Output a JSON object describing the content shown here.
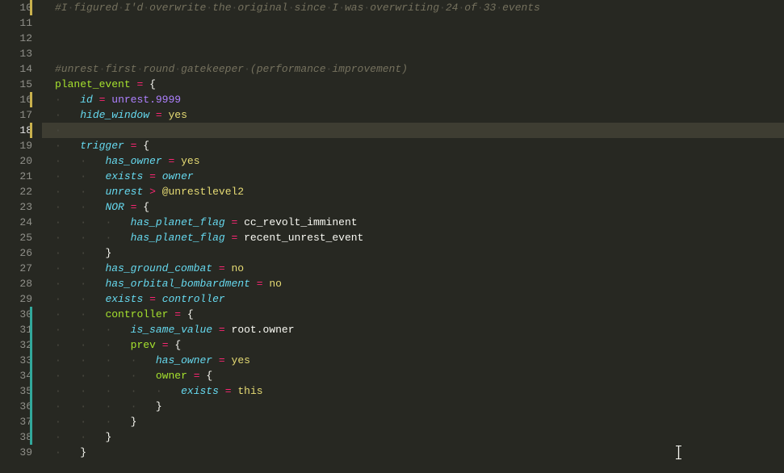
{
  "editor": {
    "first_line": 10,
    "active_line": 18,
    "caret": {
      "line": 39,
      "col": 99
    },
    "colors": {
      "background": "#272822",
      "gutter_fg": "#90908a",
      "gutter_active_fg": "#e6e6e6",
      "active_line_bg": "#3e3d32",
      "whitespace": "#4b4a41",
      "mod_yellow": "#c9b14d",
      "mod_teal": "#32a89c"
    },
    "lines": [
      {
        "num": 10,
        "indent": 0,
        "mod": "yellow",
        "tokens": [
          [
            "comment",
            "#I"
          ],
          [
            "ws",
            "·"
          ],
          [
            "comment",
            "figured"
          ],
          [
            "ws",
            "·"
          ],
          [
            "comment",
            "I'd"
          ],
          [
            "ws",
            "·"
          ],
          [
            "comment",
            "overwrite"
          ],
          [
            "ws",
            "·"
          ],
          [
            "comment",
            "the"
          ],
          [
            "ws",
            "·"
          ],
          [
            "comment",
            "original"
          ],
          [
            "ws",
            "·"
          ],
          [
            "comment",
            "since"
          ],
          [
            "ws",
            "·"
          ],
          [
            "comment",
            "I"
          ],
          [
            "ws",
            "·"
          ],
          [
            "comment",
            "was"
          ],
          [
            "ws",
            "·"
          ],
          [
            "comment",
            "overwriting"
          ],
          [
            "ws",
            "·"
          ],
          [
            "comment",
            "24"
          ],
          [
            "ws",
            "·"
          ],
          [
            "comment",
            "of"
          ],
          [
            "ws",
            "·"
          ],
          [
            "comment",
            "33"
          ],
          [
            "ws",
            "·"
          ],
          [
            "comment",
            "events"
          ]
        ]
      },
      {
        "num": 11,
        "indent": 0,
        "mod": null,
        "tokens": []
      },
      {
        "num": 12,
        "indent": 0,
        "mod": null,
        "tokens": []
      },
      {
        "num": 13,
        "indent": 0,
        "mod": null,
        "tokens": []
      },
      {
        "num": 14,
        "indent": 0,
        "mod": null,
        "tokens": [
          [
            "comment",
            "#unrest"
          ],
          [
            "ws",
            "·"
          ],
          [
            "comment",
            "first"
          ],
          [
            "ws",
            "·"
          ],
          [
            "comment",
            "round"
          ],
          [
            "ws",
            "·"
          ],
          [
            "comment",
            "gatekeeper"
          ],
          [
            "ws",
            "·"
          ],
          [
            "comment",
            "(performance"
          ],
          [
            "ws",
            "·"
          ],
          [
            "comment",
            "improvement)"
          ]
        ]
      },
      {
        "num": 15,
        "indent": 0,
        "mod": null,
        "tokens": [
          [
            "keyword",
            "planet_event"
          ],
          [
            "plain",
            " "
          ],
          [
            "op",
            "="
          ],
          [
            "plain",
            " "
          ],
          [
            "punc",
            "{"
          ]
        ]
      },
      {
        "num": 16,
        "indent": 1,
        "mod": "yellow",
        "tokens": [
          [
            "ident",
            "id"
          ],
          [
            "plain",
            " "
          ],
          [
            "op",
            "="
          ],
          [
            "plain",
            " "
          ],
          [
            "number",
            "unrest.9999"
          ]
        ]
      },
      {
        "num": 17,
        "indent": 1,
        "mod": null,
        "tokens": [
          [
            "ident",
            "hide_window"
          ],
          [
            "plain",
            " "
          ],
          [
            "op",
            "="
          ],
          [
            "plain",
            " "
          ],
          [
            "val",
            "yes"
          ]
        ]
      },
      {
        "num": 18,
        "indent": 1,
        "mod": "yellow",
        "tokens": []
      },
      {
        "num": 19,
        "indent": 1,
        "mod": null,
        "tokens": [
          [
            "ident",
            "trigger"
          ],
          [
            "plain",
            " "
          ],
          [
            "op",
            "="
          ],
          [
            "plain",
            " "
          ],
          [
            "punc",
            "{"
          ]
        ]
      },
      {
        "num": 20,
        "indent": 2,
        "mod": null,
        "tokens": [
          [
            "ident",
            "has_owner"
          ],
          [
            "plain",
            " "
          ],
          [
            "op",
            "="
          ],
          [
            "plain",
            " "
          ],
          [
            "val",
            "yes"
          ]
        ]
      },
      {
        "num": 21,
        "indent": 2,
        "mod": null,
        "tokens": [
          [
            "ident",
            "exists"
          ],
          [
            "plain",
            " "
          ],
          [
            "op",
            "="
          ],
          [
            "plain",
            " "
          ],
          [
            "ident",
            "owner"
          ]
        ]
      },
      {
        "num": 22,
        "indent": 2,
        "mod": null,
        "tokens": [
          [
            "ident",
            "unrest"
          ],
          [
            "plain",
            " "
          ],
          [
            "op",
            ">"
          ],
          [
            "plain",
            " "
          ],
          [
            "val",
            "@unrestlevel2"
          ]
        ]
      },
      {
        "num": 23,
        "indent": 2,
        "mod": null,
        "tokens": [
          [
            "ident",
            "NOR"
          ],
          [
            "plain",
            " "
          ],
          [
            "op",
            "="
          ],
          [
            "plain",
            " "
          ],
          [
            "punc",
            "{"
          ]
        ]
      },
      {
        "num": 24,
        "indent": 3,
        "mod": null,
        "tokens": [
          [
            "ident",
            "has_planet_flag"
          ],
          [
            "plain",
            " "
          ],
          [
            "op",
            "="
          ],
          [
            "plain",
            " "
          ],
          [
            "plain",
            "cc_revolt_imminent"
          ]
        ]
      },
      {
        "num": 25,
        "indent": 3,
        "mod": null,
        "tokens": [
          [
            "ident",
            "has_planet_flag"
          ],
          [
            "plain",
            " "
          ],
          [
            "op",
            "="
          ],
          [
            "plain",
            " "
          ],
          [
            "plain",
            "recent_unrest_event"
          ]
        ]
      },
      {
        "num": 26,
        "indent": 2,
        "mod": null,
        "tokens": [
          [
            "punc",
            "}"
          ]
        ]
      },
      {
        "num": 27,
        "indent": 2,
        "mod": null,
        "tokens": [
          [
            "ident",
            "has_ground_combat"
          ],
          [
            "plain",
            " "
          ],
          [
            "op",
            "="
          ],
          [
            "plain",
            " "
          ],
          [
            "val",
            "no"
          ]
        ]
      },
      {
        "num": 28,
        "indent": 2,
        "mod": null,
        "tokens": [
          [
            "ident",
            "has_orbital_bombardment"
          ],
          [
            "plain",
            " "
          ],
          [
            "op",
            "="
          ],
          [
            "plain",
            " "
          ],
          [
            "val",
            "no"
          ]
        ]
      },
      {
        "num": 29,
        "indent": 2,
        "mod": null,
        "tokens": [
          [
            "ident",
            "exists"
          ],
          [
            "plain",
            " "
          ],
          [
            "op",
            "="
          ],
          [
            "plain",
            " "
          ],
          [
            "ident",
            "controller"
          ]
        ]
      },
      {
        "num": 30,
        "indent": 2,
        "mod": "teal",
        "tokens": [
          [
            "keyword",
            "controller"
          ],
          [
            "plain",
            " "
          ],
          [
            "op",
            "="
          ],
          [
            "plain",
            " "
          ],
          [
            "punc",
            "{"
          ]
        ]
      },
      {
        "num": 31,
        "indent": 3,
        "mod": "teal",
        "tokens": [
          [
            "ident",
            "is_same_value"
          ],
          [
            "plain",
            " "
          ],
          [
            "op",
            "="
          ],
          [
            "plain",
            " "
          ],
          [
            "plain",
            "root.owner"
          ]
        ]
      },
      {
        "num": 32,
        "indent": 3,
        "mod": "teal",
        "tokens": [
          [
            "keyword",
            "prev"
          ],
          [
            "plain",
            " "
          ],
          [
            "op",
            "="
          ],
          [
            "plain",
            " "
          ],
          [
            "punc",
            "{"
          ]
        ]
      },
      {
        "num": 33,
        "indent": 4,
        "mod": "teal",
        "tokens": [
          [
            "ident",
            "has_owner"
          ],
          [
            "plain",
            " "
          ],
          [
            "op",
            "="
          ],
          [
            "plain",
            " "
          ],
          [
            "val",
            "yes"
          ]
        ]
      },
      {
        "num": 34,
        "indent": 4,
        "mod": "teal",
        "tokens": [
          [
            "keyword",
            "owner"
          ],
          [
            "plain",
            " "
          ],
          [
            "op",
            "="
          ],
          [
            "plain",
            " "
          ],
          [
            "punc",
            "{"
          ]
        ]
      },
      {
        "num": 35,
        "indent": 5,
        "mod": "teal",
        "tokens": [
          [
            "ident",
            "exists"
          ],
          [
            "plain",
            " "
          ],
          [
            "op",
            "="
          ],
          [
            "plain",
            " "
          ],
          [
            "val",
            "this"
          ]
        ]
      },
      {
        "num": 36,
        "indent": 4,
        "mod": "teal",
        "tokens": [
          [
            "punc",
            "}"
          ]
        ]
      },
      {
        "num": 37,
        "indent": 3,
        "mod": "teal",
        "tokens": [
          [
            "punc",
            "}"
          ]
        ]
      },
      {
        "num": 38,
        "indent": 2,
        "mod": "teal",
        "tokens": [
          [
            "punc",
            "}"
          ]
        ]
      },
      {
        "num": 39,
        "indent": 1,
        "mod": null,
        "tokens": [
          [
            "punc",
            "}"
          ]
        ]
      }
    ]
  },
  "chart_data": null
}
